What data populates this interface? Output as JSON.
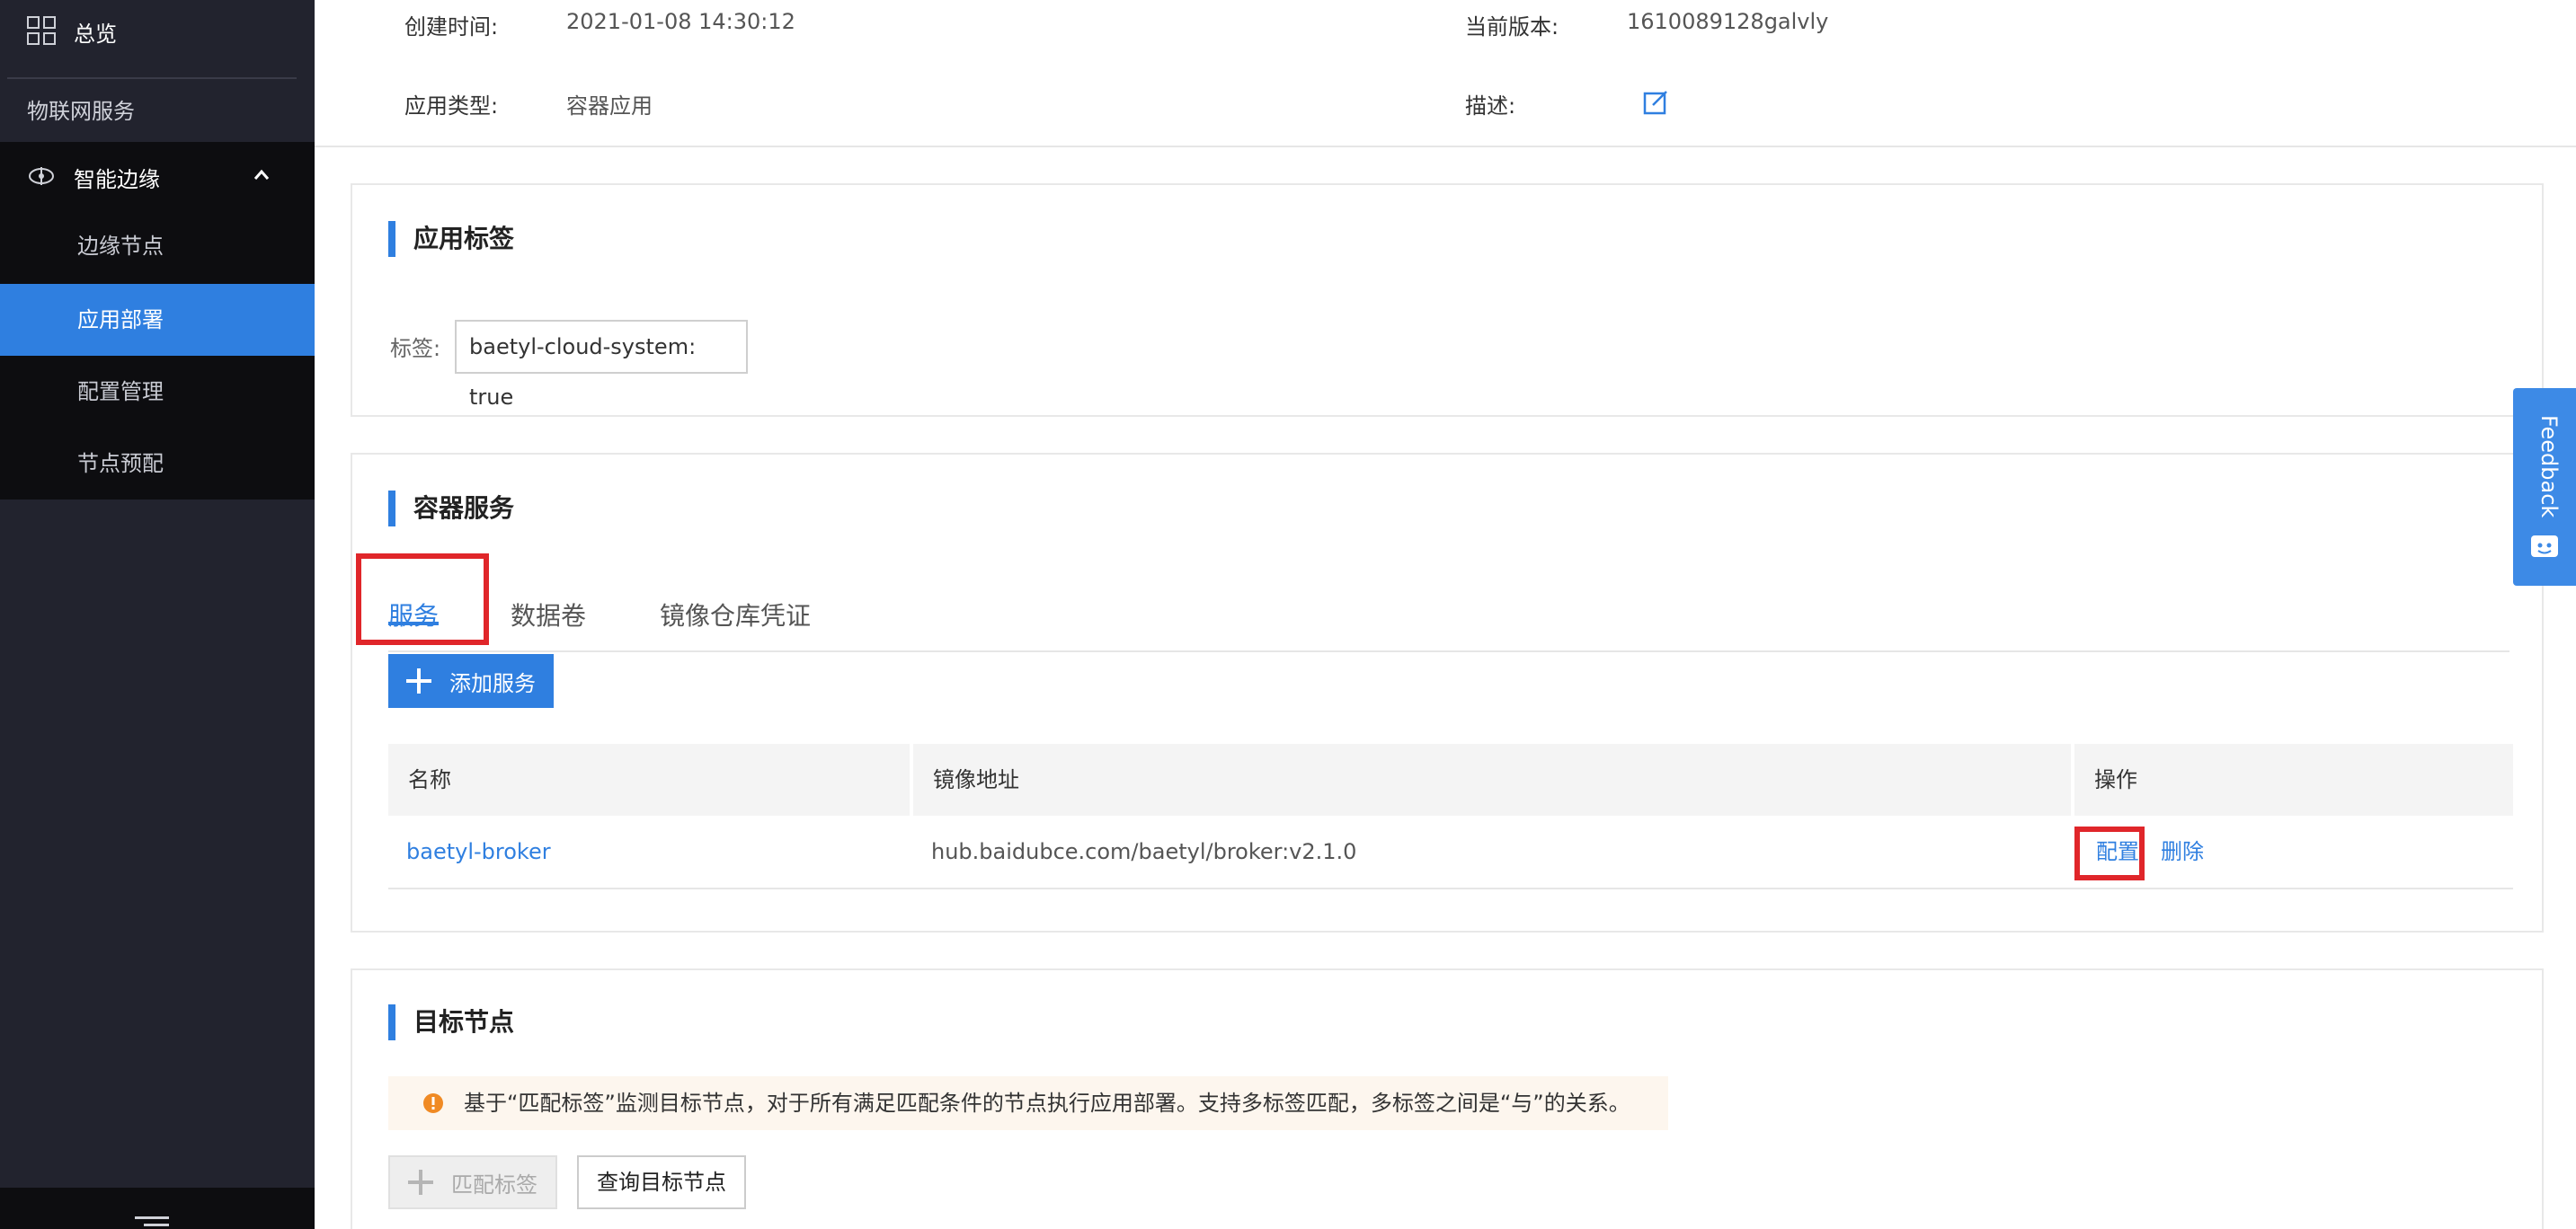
{
  "sidebar": {
    "overview_label": "总览",
    "iot_label": "物联网服务",
    "edge_group_label": "智能边缘",
    "items": [
      {
        "label": "边缘节点"
      },
      {
        "label": "应用部署"
      },
      {
        "label": "配置管理"
      },
      {
        "label": "节点预配"
      }
    ],
    "active_index": 1
  },
  "app_info": {
    "created_label": "创建时间:",
    "created_value": "2021-01-08 14:30:12",
    "version_label": "当前版本:",
    "version_value": "1610089128galvly",
    "type_label": "应用类型:",
    "type_value": "容器应用",
    "desc_label": "描述:"
  },
  "app_tags": {
    "title": "应用标签",
    "tag_label": "标签:",
    "tag_value": "baetyl-cloud-system: true"
  },
  "container_service": {
    "title": "容器服务",
    "tabs": [
      {
        "label": "服务"
      },
      {
        "label": "数据卷"
      },
      {
        "label": "镜像仓库凭证"
      }
    ],
    "active_tab": 0,
    "add_button_label": "添加服务",
    "table": {
      "columns": [
        "名称",
        "镜像地址",
        "操作"
      ],
      "rows": [
        {
          "name": "baetyl-broker",
          "image": "hub.baidubce.com/baetyl/broker:v2.1.0",
          "actions": [
            "配置",
            "删除"
          ]
        }
      ]
    }
  },
  "target_nodes": {
    "title": "目标节点",
    "notice": "基于“匹配标签”监测目标节点，对于所有满足匹配条件的节点执行应用部署。支持多标签匹配，多标签之间是“与”的关系。",
    "match_button_label": "匹配标签",
    "query_button_label": "查询目标节点"
  },
  "feedback": {
    "label": "Feedback"
  },
  "colors": {
    "accent": "#2f7fe0",
    "sidebar_bg": "#22232e",
    "highlight": "#e0262a"
  }
}
